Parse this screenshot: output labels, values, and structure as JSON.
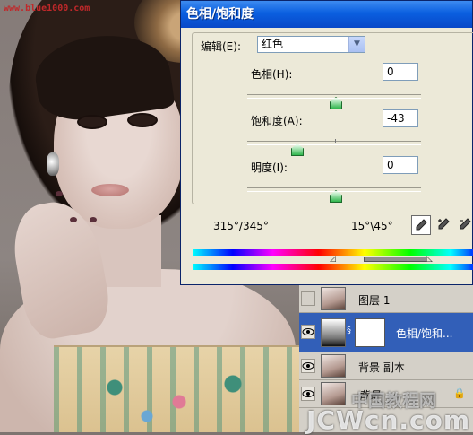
{
  "site_tag": "www.blue1000.com",
  "dialog": {
    "title": "色相/饱和度",
    "edit_label": "编辑(E):",
    "edit_value": "红色",
    "hue_label": "色相(H):",
    "hue_value": "0",
    "sat_label": "饱和度(A):",
    "sat_value": "-43",
    "light_label": "明度(I):",
    "light_value": "0",
    "range_left": "315°/345°",
    "range_right": "15°\\45°"
  },
  "layers": [
    {
      "name": "图层 1",
      "visible": false
    },
    {
      "name": "色相/饱和...",
      "visible": true,
      "selected": true
    },
    {
      "name": "背景 副本",
      "visible": true
    },
    {
      "name": "背景",
      "visible": true,
      "locked": true
    }
  ],
  "watermark": "JCWcn.com",
  "watermark_cn": "中国教程网"
}
